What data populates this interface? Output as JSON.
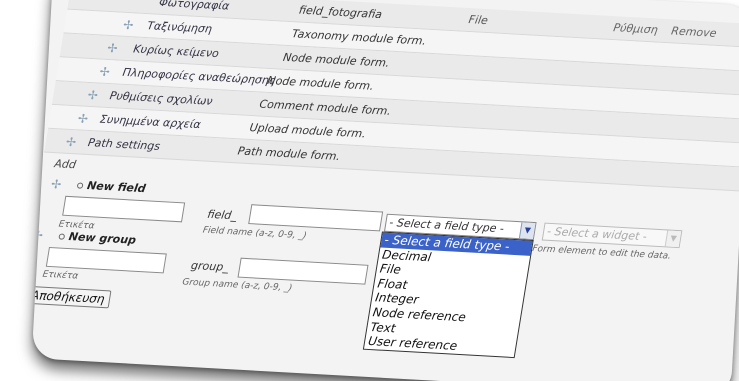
{
  "rows": [
    {
      "label": "Φωτογραφία",
      "name": "field_fotografia",
      "type": "File",
      "configure": "Ρύθμιση",
      "remove": "Remove"
    },
    {
      "label": "Ταξινόμηση",
      "type": "Taxonomy module form."
    },
    {
      "label": "Κυρίως κείμενο",
      "type": "Node module form."
    },
    {
      "label": "Πληροφορίες αναθεώρησης",
      "type": "Node module form."
    },
    {
      "label": "Ρυθμίσεις σχολίων",
      "type": "Comment module form."
    },
    {
      "label": "Συνημμένα αρχεία",
      "type": "Upload module form."
    },
    {
      "label": "Path settings",
      "type": "Path module form."
    }
  ],
  "add": {
    "heading": "Add",
    "new_field": {
      "title": "New field",
      "label_caption": "Ετικέτα",
      "name_prefix": "field_",
      "name_help": "Field name (a-z, 0-9, _)",
      "field_type_selected": "- Select a field type -",
      "widget_selected": "- Select a widget -",
      "widget_help": "Form element to edit the data."
    },
    "new_group": {
      "title": "New group",
      "label_caption": "Ετικέτα",
      "name_prefix": "group_",
      "name_help": "Group name (a-z, 0-9, _)"
    }
  },
  "field_type_options": [
    "- Select a field type -",
    "Decimal",
    "File",
    "Float",
    "Integer",
    "Node reference",
    "Text",
    "User reference"
  ],
  "save_button": "Αποθήκευση",
  "icons": {
    "drag": "cross-drag-icon",
    "radio": "radio-icon",
    "dropdown": "chevron-down-icon"
  }
}
